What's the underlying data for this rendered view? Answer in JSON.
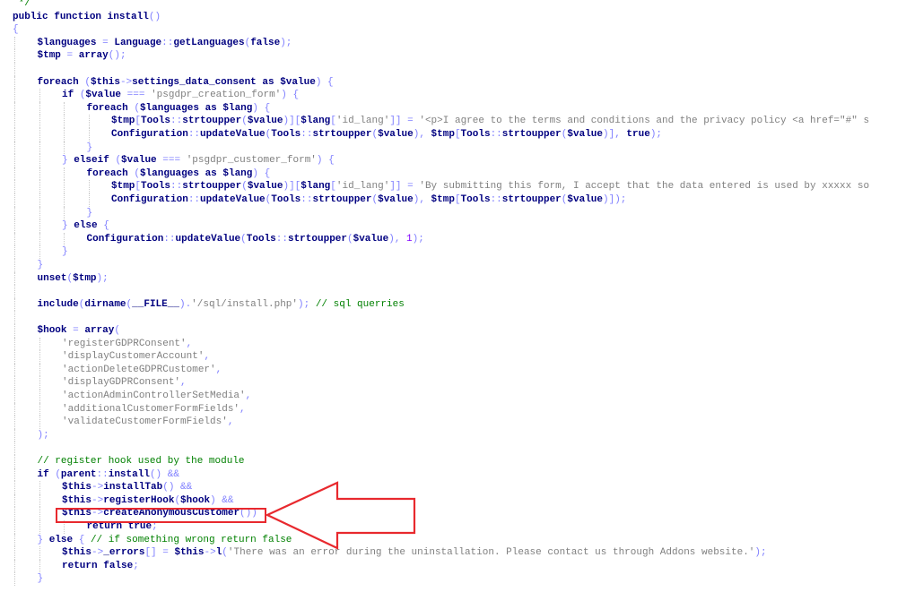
{
  "colors": {
    "keyword": "#000080",
    "punctuation": "#8080ff",
    "string": "#808080",
    "comment": "#008000",
    "number": "#8000ff",
    "text": "#000000",
    "indent_guide": "#c8c8c8",
    "annotation": "#e8292e"
  },
  "annotation": {
    "highlight_target": "$this->createAnonymousCustomer()",
    "arrow_direction": "left"
  },
  "code_lines": [
    {
      "indent": 0,
      "tokens": [
        [
          "c",
          " */"
        ]
      ]
    },
    {
      "indent": 0,
      "tokens": [
        [
          "k",
          "public"
        ],
        [
          "x",
          " "
        ],
        [
          "k",
          "function"
        ],
        [
          "x",
          " "
        ],
        [
          "t",
          "install"
        ],
        [
          "p",
          "()"
        ]
      ]
    },
    {
      "indent": 0,
      "tokens": [
        [
          "p",
          "{"
        ]
      ]
    },
    {
      "indent": 1,
      "tokens": [
        [
          "v",
          "$languages"
        ],
        [
          "x",
          " "
        ],
        [
          "p",
          "="
        ],
        [
          "x",
          " "
        ],
        [
          "t",
          "Language"
        ],
        [
          "p",
          "::"
        ],
        [
          "t",
          "getLanguages"
        ],
        [
          "p",
          "("
        ],
        [
          "k",
          "false"
        ],
        [
          "p",
          ");"
        ]
      ]
    },
    {
      "indent": 1,
      "tokens": [
        [
          "v",
          "$tmp"
        ],
        [
          "x",
          " "
        ],
        [
          "p",
          "="
        ],
        [
          "x",
          " "
        ],
        [
          "k",
          "array"
        ],
        [
          "p",
          "();"
        ]
      ]
    },
    {
      "indent": 1,
      "tokens": []
    },
    {
      "indent": 1,
      "tokens": [
        [
          "k",
          "foreach"
        ],
        [
          "x",
          " "
        ],
        [
          "p",
          "("
        ],
        [
          "v",
          "$this"
        ],
        [
          "p",
          "->"
        ],
        [
          "t",
          "settings_data_consent"
        ],
        [
          "x",
          " "
        ],
        [
          "k",
          "as"
        ],
        [
          "x",
          " "
        ],
        [
          "v",
          "$value"
        ],
        [
          "p",
          ")"
        ],
        [
          "x",
          " "
        ],
        [
          "p",
          "{"
        ]
      ]
    },
    {
      "indent": 2,
      "tokens": [
        [
          "k",
          "if"
        ],
        [
          "x",
          " "
        ],
        [
          "p",
          "("
        ],
        [
          "v",
          "$value"
        ],
        [
          "x",
          " "
        ],
        [
          "p",
          "==="
        ],
        [
          "x",
          " "
        ],
        [
          "s",
          "'psgdpr_creation_form'"
        ],
        [
          "p",
          ")"
        ],
        [
          "x",
          " "
        ],
        [
          "p",
          "{"
        ]
      ]
    },
    {
      "indent": 3,
      "tokens": [
        [
          "k",
          "foreach"
        ],
        [
          "x",
          " "
        ],
        [
          "p",
          "("
        ],
        [
          "v",
          "$languages"
        ],
        [
          "x",
          " "
        ],
        [
          "k",
          "as"
        ],
        [
          "x",
          " "
        ],
        [
          "v",
          "$lang"
        ],
        [
          "p",
          ")"
        ],
        [
          "x",
          " "
        ],
        [
          "p",
          "{"
        ]
      ]
    },
    {
      "indent": 4,
      "tokens": [
        [
          "v",
          "$tmp"
        ],
        [
          "p",
          "["
        ],
        [
          "t",
          "Tools"
        ],
        [
          "p",
          "::"
        ],
        [
          "k",
          "strtoupper"
        ],
        [
          "p",
          "("
        ],
        [
          "v",
          "$value"
        ],
        [
          "p",
          ")]["
        ],
        [
          "v",
          "$lang"
        ],
        [
          "p",
          "["
        ],
        [
          "s",
          "'id_lang'"
        ],
        [
          "p",
          "]]"
        ],
        [
          "x",
          " "
        ],
        [
          "p",
          "="
        ],
        [
          "x",
          " "
        ],
        [
          "s",
          "'<p>I agree to the terms and conditions and the privacy policy <a href=\"#\" s"
        ]
      ]
    },
    {
      "indent": 4,
      "tokens": [
        [
          "t",
          "Configuration"
        ],
        [
          "p",
          "::"
        ],
        [
          "t",
          "updateValue"
        ],
        [
          "p",
          "("
        ],
        [
          "t",
          "Tools"
        ],
        [
          "p",
          "::"
        ],
        [
          "k",
          "strtoupper"
        ],
        [
          "p",
          "("
        ],
        [
          "v",
          "$value"
        ],
        [
          "p",
          "),"
        ],
        [
          "x",
          " "
        ],
        [
          "v",
          "$tmp"
        ],
        [
          "p",
          "["
        ],
        [
          "t",
          "Tools"
        ],
        [
          "p",
          "::"
        ],
        [
          "k",
          "strtoupper"
        ],
        [
          "p",
          "("
        ],
        [
          "v",
          "$value"
        ],
        [
          "p",
          ")],"
        ],
        [
          "x",
          " "
        ],
        [
          "k",
          "true"
        ],
        [
          "p",
          ");"
        ]
      ]
    },
    {
      "indent": 3,
      "tokens": [
        [
          "p",
          "}"
        ]
      ]
    },
    {
      "indent": 2,
      "tokens": [
        [
          "p",
          "}"
        ],
        [
          "x",
          " "
        ],
        [
          "k",
          "elseif"
        ],
        [
          "x",
          " "
        ],
        [
          "p",
          "("
        ],
        [
          "v",
          "$value"
        ],
        [
          "x",
          " "
        ],
        [
          "p",
          "==="
        ],
        [
          "x",
          " "
        ],
        [
          "s",
          "'psgdpr_customer_form'"
        ],
        [
          "p",
          ")"
        ],
        [
          "x",
          " "
        ],
        [
          "p",
          "{"
        ]
      ]
    },
    {
      "indent": 3,
      "tokens": [
        [
          "k",
          "foreach"
        ],
        [
          "x",
          " "
        ],
        [
          "p",
          "("
        ],
        [
          "v",
          "$languages"
        ],
        [
          "x",
          " "
        ],
        [
          "k",
          "as"
        ],
        [
          "x",
          " "
        ],
        [
          "v",
          "$lang"
        ],
        [
          "p",
          ")"
        ],
        [
          "x",
          " "
        ],
        [
          "p",
          "{"
        ]
      ]
    },
    {
      "indent": 4,
      "tokens": [
        [
          "v",
          "$tmp"
        ],
        [
          "p",
          "["
        ],
        [
          "t",
          "Tools"
        ],
        [
          "p",
          "::"
        ],
        [
          "k",
          "strtoupper"
        ],
        [
          "p",
          "("
        ],
        [
          "v",
          "$value"
        ],
        [
          "p",
          ")]["
        ],
        [
          "v",
          "$lang"
        ],
        [
          "p",
          "["
        ],
        [
          "s",
          "'id_lang'"
        ],
        [
          "p",
          "]]"
        ],
        [
          "x",
          " "
        ],
        [
          "p",
          "="
        ],
        [
          "x",
          " "
        ],
        [
          "s",
          "'By submitting this form, I accept that the data entered is used by xxxxx so"
        ]
      ]
    },
    {
      "indent": 4,
      "tokens": [
        [
          "t",
          "Configuration"
        ],
        [
          "p",
          "::"
        ],
        [
          "t",
          "updateValue"
        ],
        [
          "p",
          "("
        ],
        [
          "t",
          "Tools"
        ],
        [
          "p",
          "::"
        ],
        [
          "k",
          "strtoupper"
        ],
        [
          "p",
          "("
        ],
        [
          "v",
          "$value"
        ],
        [
          "p",
          "),"
        ],
        [
          "x",
          " "
        ],
        [
          "v",
          "$tmp"
        ],
        [
          "p",
          "["
        ],
        [
          "t",
          "Tools"
        ],
        [
          "p",
          "::"
        ],
        [
          "k",
          "strtoupper"
        ],
        [
          "p",
          "("
        ],
        [
          "v",
          "$value"
        ],
        [
          "p",
          ")]);"
        ]
      ]
    },
    {
      "indent": 3,
      "tokens": [
        [
          "p",
          "}"
        ]
      ]
    },
    {
      "indent": 2,
      "tokens": [
        [
          "p",
          "}"
        ],
        [
          "x",
          " "
        ],
        [
          "k",
          "else"
        ],
        [
          "x",
          " "
        ],
        [
          "p",
          "{"
        ]
      ]
    },
    {
      "indent": 3,
      "tokens": [
        [
          "t",
          "Configuration"
        ],
        [
          "p",
          "::"
        ],
        [
          "t",
          "updateValue"
        ],
        [
          "p",
          "("
        ],
        [
          "t",
          "Tools"
        ],
        [
          "p",
          "::"
        ],
        [
          "k",
          "strtoupper"
        ],
        [
          "p",
          "("
        ],
        [
          "v",
          "$value"
        ],
        [
          "p",
          "),"
        ],
        [
          "x",
          " "
        ],
        [
          "m",
          "1"
        ],
        [
          "p",
          ");"
        ]
      ]
    },
    {
      "indent": 2,
      "tokens": [
        [
          "p",
          "}"
        ]
      ]
    },
    {
      "indent": 1,
      "tokens": [
        [
          "p",
          "}"
        ]
      ]
    },
    {
      "indent": 1,
      "tokens": [
        [
          "k",
          "unset"
        ],
        [
          "p",
          "("
        ],
        [
          "v",
          "$tmp"
        ],
        [
          "p",
          ");"
        ]
      ]
    },
    {
      "indent": 1,
      "tokens": []
    },
    {
      "indent": 1,
      "tokens": [
        [
          "k",
          "include"
        ],
        [
          "p",
          "("
        ],
        [
          "k",
          "dirname"
        ],
        [
          "p",
          "("
        ],
        [
          "k",
          "__FILE__"
        ],
        [
          "p",
          ")."
        ],
        [
          "s",
          "'/sql/install.php'"
        ],
        [
          "p",
          ");"
        ],
        [
          "x",
          " "
        ],
        [
          "c",
          "// sql querries"
        ]
      ]
    },
    {
      "indent": 1,
      "tokens": []
    },
    {
      "indent": 1,
      "tokens": [
        [
          "v",
          "$hook"
        ],
        [
          "x",
          " "
        ],
        [
          "p",
          "="
        ],
        [
          "x",
          " "
        ],
        [
          "k",
          "array"
        ],
        [
          "p",
          "("
        ]
      ]
    },
    {
      "indent": 2,
      "tokens": [
        [
          "s",
          "'registerGDPRConsent'"
        ],
        [
          "p",
          ","
        ]
      ]
    },
    {
      "indent": 2,
      "tokens": [
        [
          "s",
          "'displayCustomerAccount'"
        ],
        [
          "p",
          ","
        ]
      ]
    },
    {
      "indent": 2,
      "tokens": [
        [
          "s",
          "'actionDeleteGDPRCustomer'"
        ],
        [
          "p",
          ","
        ]
      ]
    },
    {
      "indent": 2,
      "tokens": [
        [
          "s",
          "'displayGDPRConsent'"
        ],
        [
          "p",
          ","
        ]
      ]
    },
    {
      "indent": 2,
      "tokens": [
        [
          "s",
          "'actionAdminControllerSetMedia'"
        ],
        [
          "p",
          ","
        ]
      ]
    },
    {
      "indent": 2,
      "tokens": [
        [
          "s",
          "'additionalCustomerFormFields'"
        ],
        [
          "p",
          ","
        ]
      ]
    },
    {
      "indent": 2,
      "tokens": [
        [
          "s",
          "'validateCustomerFormFields'"
        ],
        [
          "p",
          ","
        ]
      ]
    },
    {
      "indent": 1,
      "tokens": [
        [
          "p",
          ");"
        ]
      ]
    },
    {
      "indent": 1,
      "tokens": []
    },
    {
      "indent": 1,
      "tokens": [
        [
          "c",
          "// register hook used by the module"
        ]
      ]
    },
    {
      "indent": 1,
      "tokens": [
        [
          "k",
          "if"
        ],
        [
          "x",
          " "
        ],
        [
          "p",
          "("
        ],
        [
          "k",
          "parent"
        ],
        [
          "p",
          "::"
        ],
        [
          "t",
          "install"
        ],
        [
          "p",
          "()"
        ],
        [
          "x",
          " "
        ],
        [
          "p",
          "&&"
        ]
      ]
    },
    {
      "indent": 2,
      "tokens": [
        [
          "v",
          "$this"
        ],
        [
          "p",
          "->"
        ],
        [
          "t",
          "installTab"
        ],
        [
          "p",
          "()"
        ],
        [
          "x",
          " "
        ],
        [
          "p",
          "&&"
        ]
      ]
    },
    {
      "indent": 2,
      "tokens": [
        [
          "v",
          "$this"
        ],
        [
          "p",
          "->"
        ],
        [
          "t",
          "registerHook"
        ],
        [
          "p",
          "("
        ],
        [
          "v",
          "$hook"
        ],
        [
          "p",
          ")"
        ],
        [
          "x",
          " "
        ],
        [
          "p",
          "&&"
        ]
      ]
    },
    {
      "indent": 2,
      "tokens": [
        [
          "v",
          "$this"
        ],
        [
          "p",
          "->"
        ],
        [
          "t",
          "createAnonymousCustomer"
        ],
        [
          "p",
          "())"
        ]
      ]
    },
    {
      "indent": 3,
      "tokens": [
        [
          "k",
          "return"
        ],
        [
          "x",
          " "
        ],
        [
          "k",
          "true"
        ],
        [
          "p",
          ";"
        ]
      ]
    },
    {
      "indent": 1,
      "tokens": [
        [
          "p",
          "}"
        ],
        [
          "x",
          " "
        ],
        [
          "k",
          "else"
        ],
        [
          "x",
          " "
        ],
        [
          "p",
          "{"
        ],
        [
          "x",
          " "
        ],
        [
          "c",
          "// if something wrong return false"
        ]
      ]
    },
    {
      "indent": 2,
      "tokens": [
        [
          "v",
          "$this"
        ],
        [
          "p",
          "->"
        ],
        [
          "t",
          "_errors"
        ],
        [
          "p",
          "[]"
        ],
        [
          "x",
          " "
        ],
        [
          "p",
          "="
        ],
        [
          "x",
          " "
        ],
        [
          "v",
          "$this"
        ],
        [
          "p",
          "->"
        ],
        [
          "t",
          "l"
        ],
        [
          "p",
          "("
        ],
        [
          "s",
          "'There was an error during the uninstallation. Please contact us through Addons website.'"
        ],
        [
          "p",
          ");"
        ]
      ]
    },
    {
      "indent": 2,
      "tokens": [
        [
          "k",
          "return"
        ],
        [
          "x",
          " "
        ],
        [
          "k",
          "false"
        ],
        [
          "p",
          ";"
        ]
      ]
    },
    {
      "indent": 1,
      "tokens": [
        [
          "p",
          "}"
        ]
      ]
    }
  ]
}
